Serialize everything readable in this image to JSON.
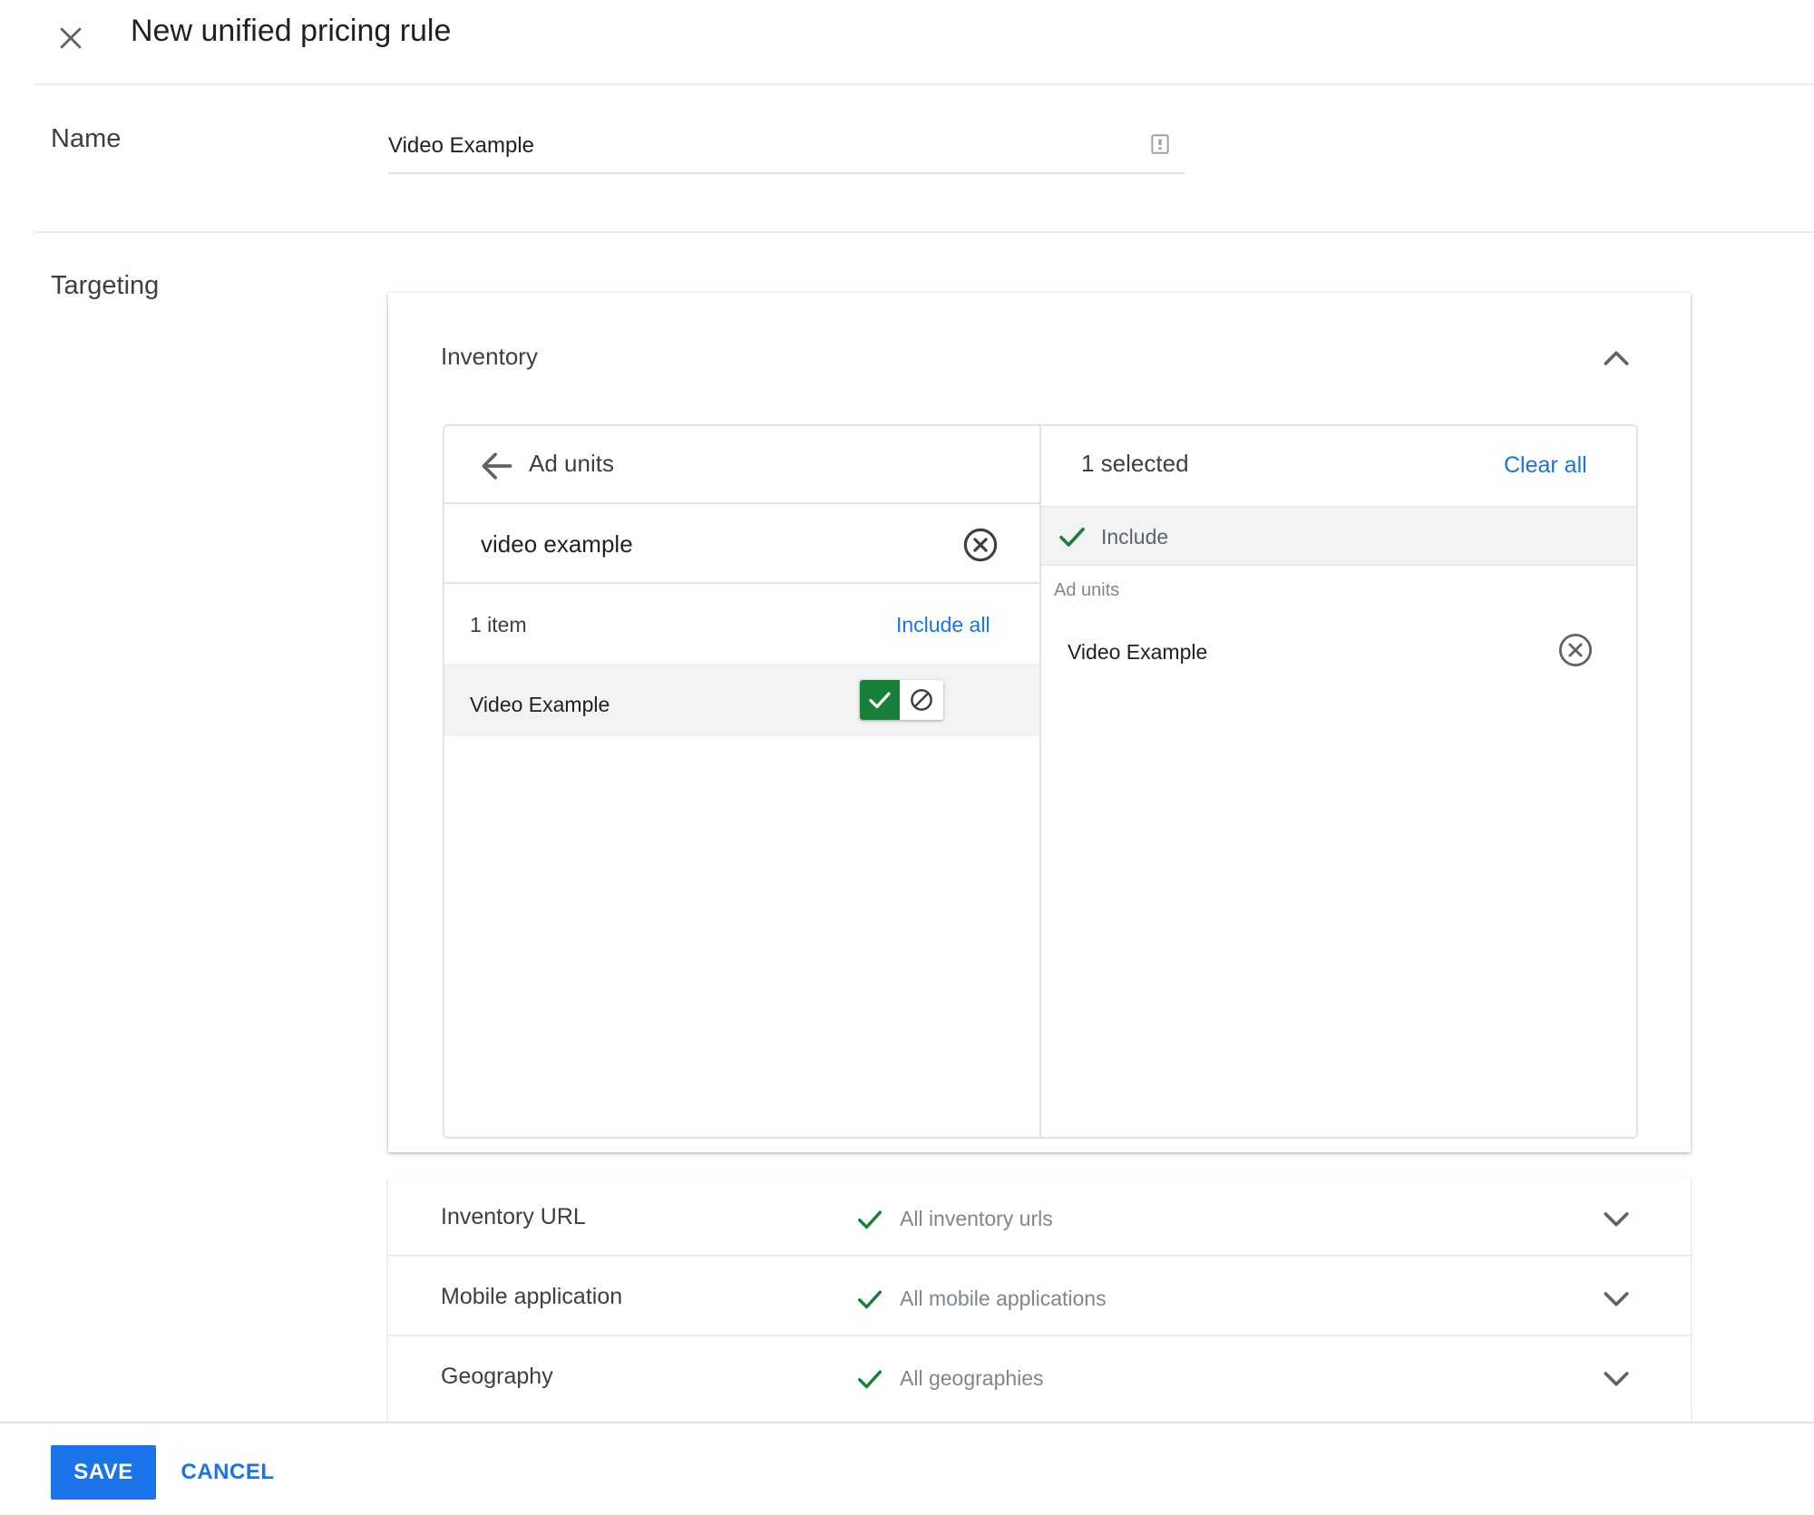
{
  "header": {
    "title": "New unified pricing rule",
    "close_icon": "close-icon"
  },
  "name_section": {
    "label": "Name",
    "value": "Video Example",
    "trailing_icon": "text-counter-icon"
  },
  "targeting": {
    "label": "Targeting",
    "inventory": {
      "title": "Inventory",
      "expanded": true,
      "left_panel": {
        "title": "Ad units",
        "search_value": "video example",
        "count_text": "1 item",
        "include_all_label": "Include all",
        "results": [
          {
            "label": "Video Example",
            "state": "included"
          }
        ]
      },
      "right_panel": {
        "selected_text": "1 selected",
        "clear_all_label": "Clear all",
        "include_label": "Include",
        "group_label": "Ad units",
        "items": [
          {
            "label": "Video Example"
          }
        ]
      }
    },
    "sections": [
      {
        "name": "Inventory URL",
        "value": "All inventory urls"
      },
      {
        "name": "Mobile application",
        "value": "All mobile applications"
      },
      {
        "name": "Geography",
        "value": "All geographies"
      }
    ]
  },
  "footer": {
    "save_label": "SAVE",
    "cancel_label": "CANCEL"
  },
  "colors": {
    "accent_blue": "#1a73e8",
    "include_green": "#188038",
    "row_highlight": "#f1f3f4"
  }
}
